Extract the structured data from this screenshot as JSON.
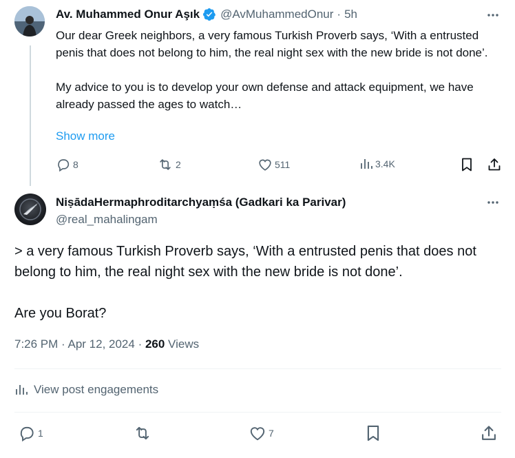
{
  "parent_tweet": {
    "author_name": "Av. Muhammed Onur Aşık",
    "handle": "@AvMuhammedOnur",
    "separator": "·",
    "time_ago": "5h",
    "body_line_1": "Our dear Greek neighbors, a very famous Turkish Proverb says, ‘With a entrusted penis that does not belong to him, the real night sex with the new bride is not done’.",
    "body_line_2": "My advice to you is to develop your own defense and attack equipment, we have already passed the ages to watch…",
    "show_more": "Show more",
    "reply_count": "8",
    "repost_count": "2",
    "like_count": "511",
    "view_count": "3.4K"
  },
  "main_tweet": {
    "author_name": "NiṣādaHermaphroditarchyaṃśa (Gadkari ka Parivar)",
    "handle": "@real_mahalingam",
    "body_line_1": "> a very famous Turkish Proverb says, ‘With a entrusted penis that does not belong to him, the real night sex with the new bride is not done’.",
    "body_line_2": "Are you Borat?",
    "timestamp": "7:26 PM · Apr 12, 2024",
    "meta_separator": " · ",
    "views_count": "260",
    "views_label": " Views",
    "engagements_label": "View post engagements",
    "reply_count": "1",
    "like_count": "7"
  },
  "colors": {
    "accent": "#1d9bf0",
    "text": "#0f1419",
    "secondary": "#536471",
    "divider": "#eff3f4"
  },
  "icons": [
    "more-icon",
    "verified-badge-icon",
    "reply-icon",
    "repost-icon",
    "like-icon",
    "views-icon",
    "bookmark-icon",
    "share-icon",
    "analytics-icon"
  ]
}
